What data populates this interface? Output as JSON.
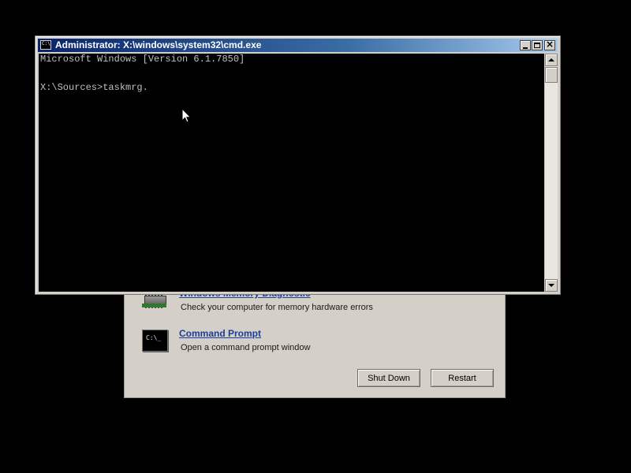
{
  "recovery": {
    "memory_diagnostic": {
      "title": "Windows Memory Diagnostic",
      "description": "Check your computer for memory hardware errors",
      "icon": "memory-chip-icon"
    },
    "command_prompt": {
      "title": "Command Prompt",
      "description": "Open a command prompt window",
      "icon": "command-prompt-icon",
      "icon_glyph": "C:\\_"
    },
    "shutdown_label": "Shut Down",
    "restart_label": "Restart"
  },
  "cmd_window": {
    "title": "Administrator: X:\\windows\\system32\\cmd.exe",
    "icon_glyph": "C:\\",
    "lines": [
      "Microsoft Windows [Version 6.1.7850]",
      "X:\\Sources>taskmrg."
    ],
    "close_glyph": "×"
  },
  "colors": {
    "titlebar_start": "#0a246a",
    "titlebar_end": "#a6caf0",
    "console_bg": "#000000",
    "console_text": "#c0c0c0",
    "link": "#1a3d9c",
    "panel": "#d4d0c8"
  }
}
